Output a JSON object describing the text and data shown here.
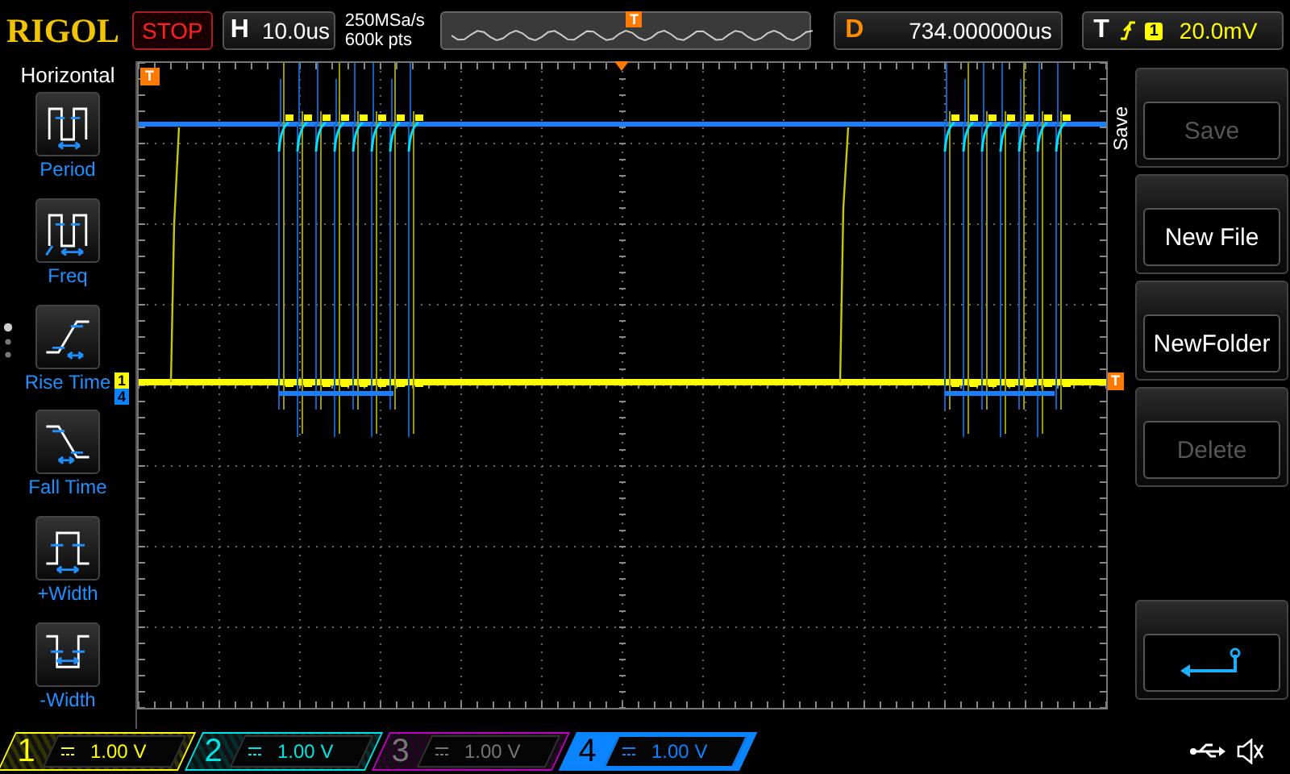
{
  "header": {
    "logo": "RIGOL",
    "run_state": "STOP",
    "timebase_label": "H",
    "timebase": "10.0us",
    "sample_rate": "250MSa/s",
    "memory_depth": "600k pts",
    "overview_marker": "T",
    "delay_label": "D",
    "delay": "734.000000us",
    "trigger_label": "T",
    "trigger_source": "1",
    "trigger_level": "20.0mV"
  },
  "measure_menu": {
    "title": "Horizontal",
    "items": [
      {
        "kind": "period",
        "label": "Period"
      },
      {
        "kind": "freq",
        "label": "Freq"
      },
      {
        "kind": "rise",
        "label": "Rise Time"
      },
      {
        "kind": "fall",
        "label": "Fall Time"
      },
      {
        "kind": "pwidth",
        "label": "+Width"
      },
      {
        "kind": "nwidth",
        "label": "-Width"
      }
    ]
  },
  "plot": {
    "trigger_position_marker": "T",
    "trigger_level_marker": "T",
    "channel_markers": [
      {
        "label": "1",
        "color": "#ffff00"
      },
      {
        "label": "4",
        "color": "#0a84ff"
      }
    ]
  },
  "save_menu": {
    "title": "Save",
    "buttons": [
      {
        "kind": "text",
        "label": "Save",
        "disabled": true
      },
      {
        "kind": "text",
        "label": "New File",
        "disabled": false
      },
      {
        "kind": "text",
        "label": "NewFolder",
        "disabled": false
      },
      {
        "kind": "text",
        "label": "Delete",
        "disabled": true
      },
      {
        "kind": "back"
      }
    ]
  },
  "channels": [
    {
      "number": "1",
      "scale": "1.00 V",
      "color": "#ffff00",
      "enabled": true,
      "selected": false
    },
    {
      "number": "2",
      "scale": "1.00 V",
      "color": "#00e5e5",
      "enabled": true,
      "selected": false
    },
    {
      "number": "3",
      "scale": "1.00 V",
      "color": "#c000c0",
      "enabled": false,
      "selected": false
    },
    {
      "number": "4",
      "scale": "1.00 V",
      "color": "#0a84ff",
      "enabled": true,
      "selected": true
    }
  ]
}
